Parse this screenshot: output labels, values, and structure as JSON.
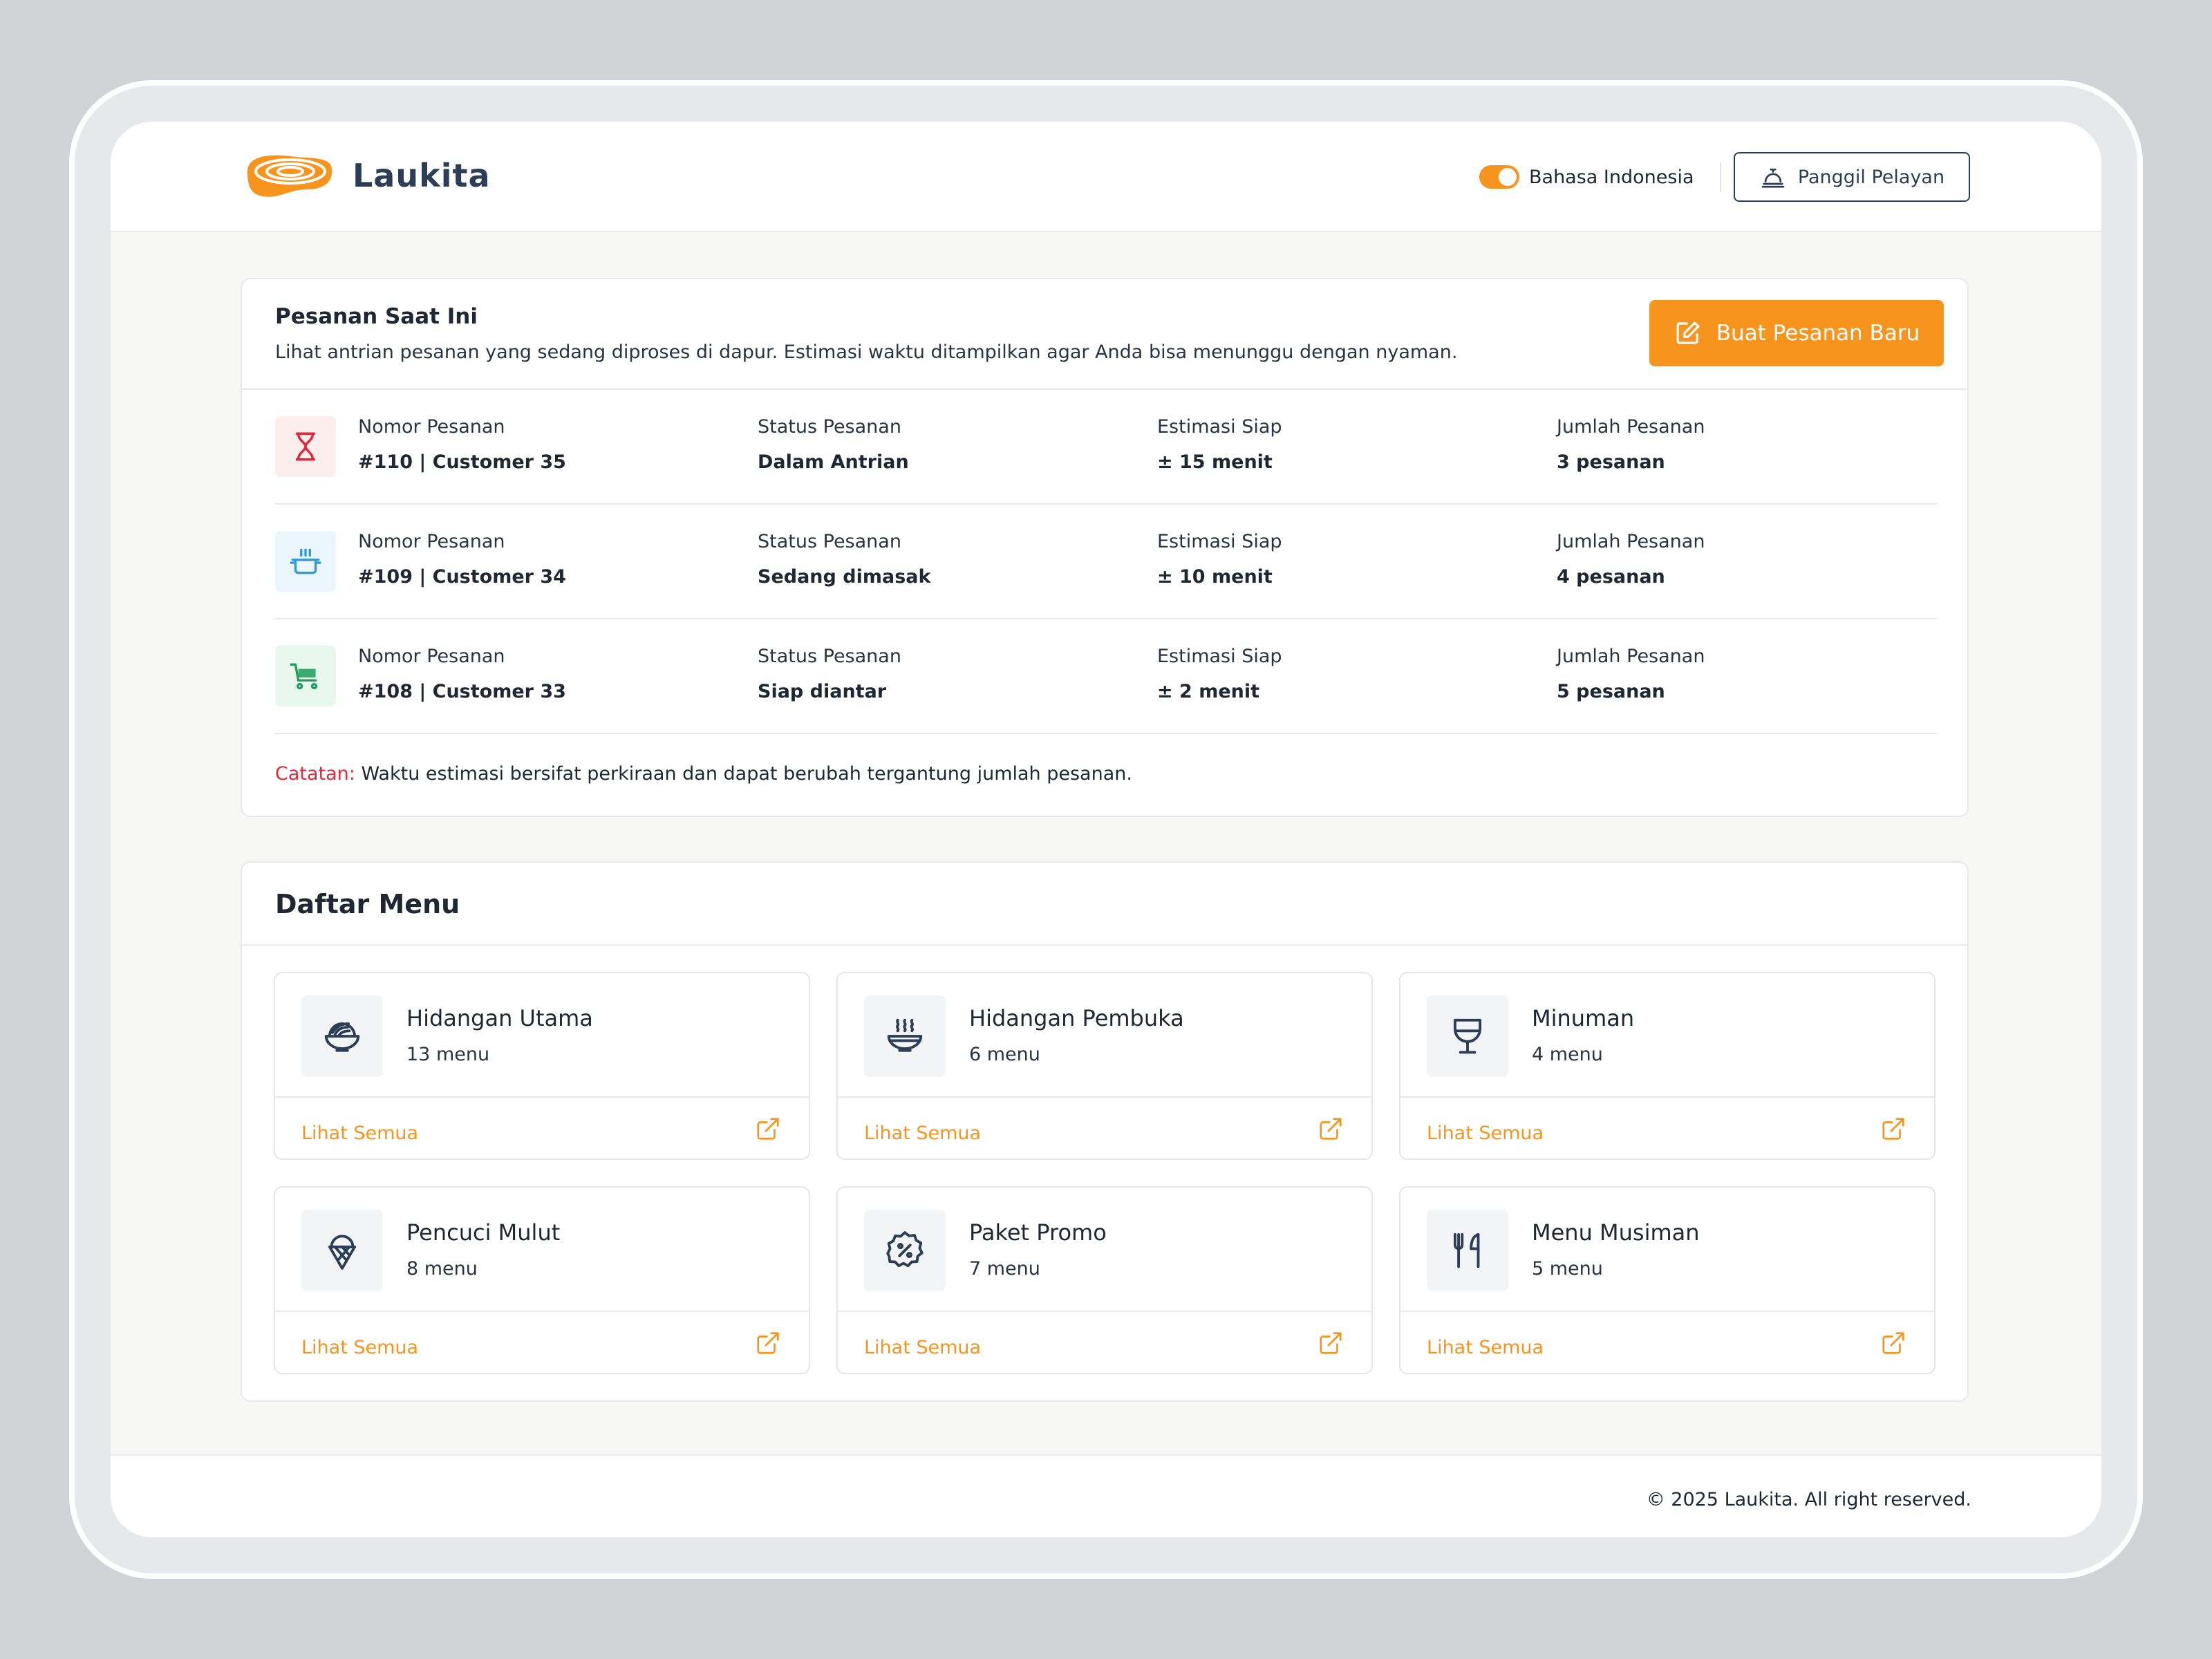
{
  "brand": {
    "name": "Laukita"
  },
  "header": {
    "language_label": "Bahasa Indonesia",
    "call_button_label": "Panggil Pelayan"
  },
  "orders": {
    "title": "Pesanan Saat Ini",
    "subtitle": "Lihat antrian pesanan yang sedang diproses di dapur. Estimasi waktu ditampilkan agar Anda bisa menunggu dengan nyaman.",
    "new_order_label": "Buat Pesanan Baru",
    "column_labels": {
      "number": "Nomor Pesanan",
      "status": "Status Pesanan",
      "eta": "Estimasi Siap",
      "count": "Jumlah Pesanan"
    },
    "rows": [
      {
        "number": "#110 | Customer 35",
        "status": "Dalam Antrian",
        "eta": "± 15 menit",
        "count": "3 pesanan",
        "icon": "hourglass-icon"
      },
      {
        "number": "#109 | Customer 34",
        "status": "Sedang dimasak",
        "eta": "± 10 menit",
        "count": "4 pesanan",
        "icon": "cooking-pot-icon"
      },
      {
        "number": "#108 | Customer 33",
        "status": "Siap diantar",
        "eta": "± 2 menit",
        "count": "5 pesanan",
        "icon": "cart-icon"
      }
    ],
    "note_key": "Catatan:",
    "note_text": " Waktu estimasi bersifat perkiraan dan dapat berubah tergantung jumlah pesanan."
  },
  "menu": {
    "title": "Daftar Menu",
    "link_label": "Lihat Semua",
    "categories": [
      {
        "name": "Hidangan Utama",
        "count": "13 menu",
        "icon": "noodle-bowl-icon"
      },
      {
        "name": "Hidangan Pembuka",
        "count": "6 menu",
        "icon": "soup-bowl-icon"
      },
      {
        "name": "Minuman",
        "count": "4 menu",
        "icon": "wine-glass-icon"
      },
      {
        "name": "Pencuci Mulut",
        "count": "8 menu",
        "icon": "ice-cream-icon"
      },
      {
        "name": "Paket Promo",
        "count": "7 menu",
        "icon": "discount-badge-icon"
      },
      {
        "name": "Menu Musiman",
        "count": "5 menu",
        "icon": "utensils-icon"
      }
    ]
  },
  "footer": {
    "copyright": "© 2025 Laukita. All right reserved."
  },
  "colors": {
    "accent": "#f7941d",
    "navy": "#2c3e55",
    "alert": "#e02a3c",
    "queue_icon_bg": "#fdeeee",
    "cooking_icon_bg": "#ebf5fc",
    "ready_icon_bg": "#e9f8ef"
  }
}
